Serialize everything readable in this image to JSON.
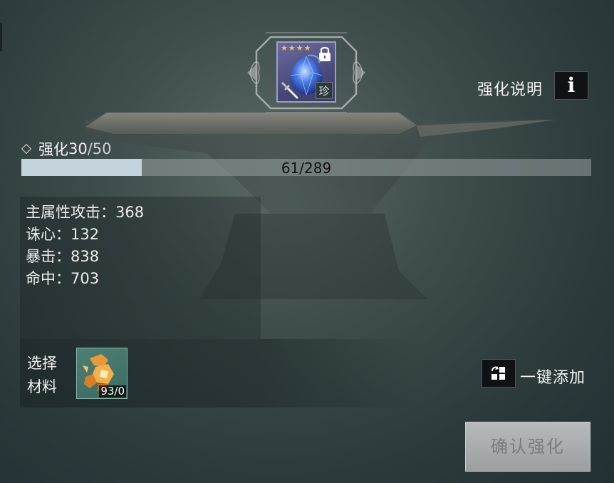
{
  "item": {
    "stars": [
      "★",
      "★",
      "★",
      "★"
    ],
    "rarity": "珍",
    "icon": "blue-gem-icon",
    "locked": true
  },
  "help": {
    "label": "强化说明",
    "icon": "i"
  },
  "enhance": {
    "label": "强化",
    "current_level": "30",
    "max_level": "/50",
    "exp_text": "61/289",
    "exp_current": 61,
    "exp_max": 289
  },
  "stats": [
    {
      "text": "主属性攻击：368"
    },
    {
      "text": "诛心：132"
    },
    {
      "text": "暴击：838"
    },
    {
      "text": "命中：703"
    }
  ],
  "materials": {
    "label_line1": "选择",
    "label_line2": "材料",
    "slot_icon": "amber-ore-icon",
    "count": "93/0"
  },
  "auto_add": {
    "label": "一键添加",
    "icon": "auto-add-icon"
  },
  "confirm": {
    "label": "确认强化"
  },
  "colors": {
    "progress_fill": "#c4d4dc",
    "star": "#f2c84b",
    "card_bg": "#4a4a7a"
  }
}
